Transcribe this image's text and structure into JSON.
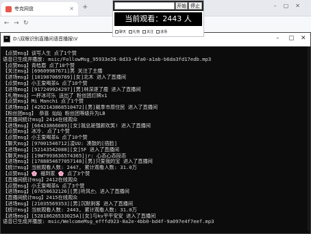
{
  "browser": {
    "tab_title": "夸克网盘",
    "tab_close": "×",
    "new_tab": "+",
    "window_controls": "–▢✕",
    "back": "←",
    "forward": "→",
    "reload": "↻"
  },
  "overlay": {
    "start_label": "开始",
    "stop_label": "停止",
    "viewer_text": "当前观看：2443 人",
    "options": [
      "聊天",
      "礼物",
      "关注",
      "进场"
    ]
  },
  "console": {
    "title": "D:\\双眼识别直播间语音播报\\V",
    "minimize": "–",
    "maximize": "▢",
    "close": "✕",
    "lines": [
      "【点赞msg】谈写人生 点了1个赞",
      "语音已生成并播放: msic/FollowMsg_95933e26-8d33-4fa0-a1ab-b6da3fd17edb.mp3",
      "【点赞msg】青桔眉 点了10个赞",
      "【关注msg】[69609987671]男 关注了主播",
      "【进场msg】[101907069769][女]北木 进入了直播间",
      "【点赞msg】小王爱喝茶& 点了10个赞",
      "【进场msg】[917249924297][男]林深逐了鹿 进入了直播间",
      "【礼物msg】一杯冰可乐 送出了 粉丝团灯牌x1",
      "【点赞msg】Mi Manchi 点了1个赞",
      "【进场msg】[4292143868510472][男]戴拿市原住民 进入了直播间",
      "【粉丝团msg】 恭喜 灿灿 粉丝团等级升为LB",
      "【直播间统计msg】2414在线观众",
      "【进场msg】[66433866089][女]我总是强颜欢笑! 进入了直播间",
      "【点赞msg】冰冷. 点了1个赞",
      "【点赞msg】小王爱喝茶& 点了10个赞",
      "【聊天msg】[97001546712]凌UU: 凑鼓的[捂脸]",
      "【进场msg】[52143542088][女]5F 进入了直播间",
      "【聊天msg】[19W7993636574365]jr: 心态心态段态",
      "【进场msg】[1788854677057148][男]只爱我的宝 进入了直播间",
      "【统计msg】当前观看人数: 2447, 累计观看人数: 31.0万",
      "【点赞msg】🌸 福到家 🌸 点了3个赞",
      "【直播间统计msg】2412在线观众",
      "【点赞msg】小王爱喝茶& 点了3个赞",
      "【进场msg】[67650632126][男]听风🌥 进入了直播间",
      "【直播间统计msg】2415在线观众",
      "【进场msg】[21035569353][男]沉默刺客 进入了直播间",
      "【统计msg】当前观看人数: 2443, 累计观看人数: 31.0万",
      "【进场msg】[52818626533025A][女]与kv平平安安 进入了直播间",
      "语音已生成并播放: msic/WelcomeMsg_efffd923-8a2e-4bb0-bd4f-9a097e4f7eef.mp3"
    ]
  }
}
